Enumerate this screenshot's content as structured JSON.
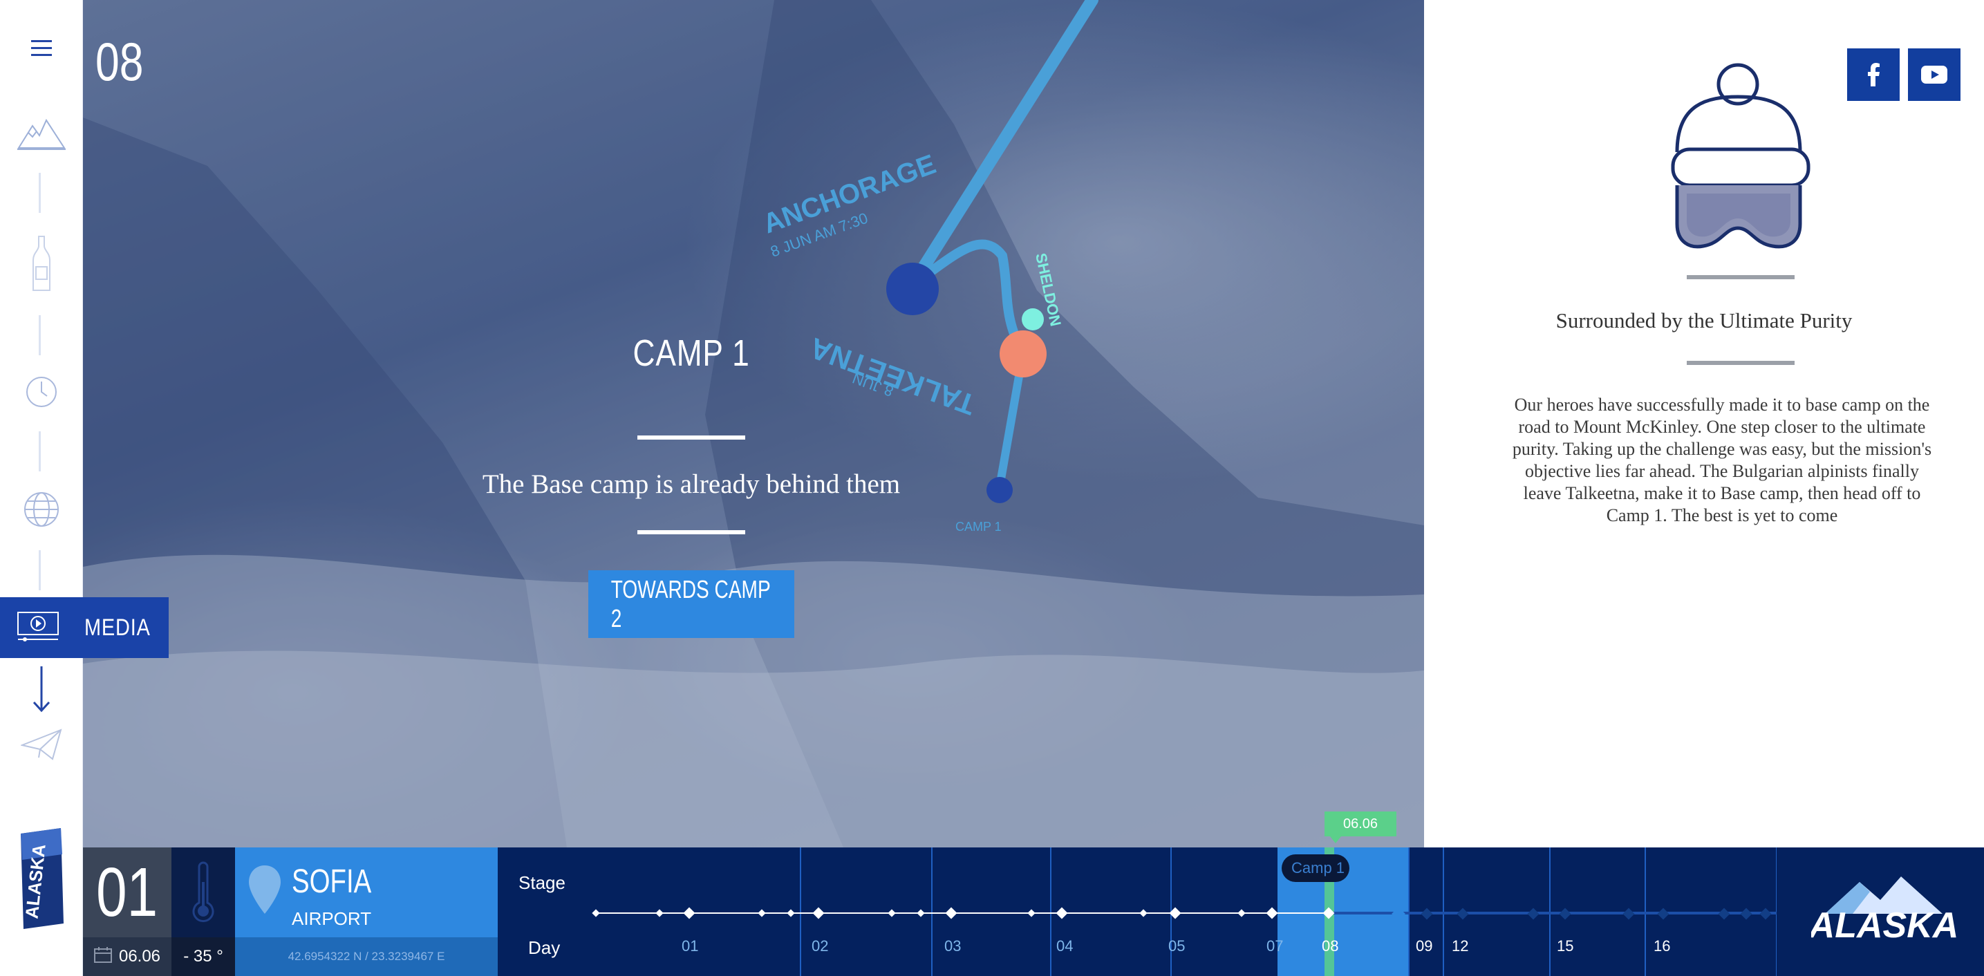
{
  "sidebar": {
    "media_label": "MEDIA",
    "icons": [
      "menu-icon",
      "mountain-icon",
      "bottle-icon",
      "clock-icon",
      "globe-icon",
      "media-play-icon",
      "arrow-down-icon",
      "paper-plane-icon"
    ],
    "logo_text": "ALASKA"
  },
  "hero": {
    "stage_number": "08",
    "title": "CAMP 1",
    "subtitle": "The Base camp is already behind them",
    "cta_label": "TOWARDS CAMP 2",
    "route_labels": {
      "anchorage": "ANCHORAGE",
      "anchorage_date": "8 JUN AM 7:30",
      "sheldon": "SHELDON",
      "talkeetna": "TALKEETNA",
      "talkeetna_date": "8 JUN",
      "camp1": "CAMP 1"
    },
    "colors": {
      "route": "#4aa0d8",
      "anchorage": "#2446a6",
      "talkeetna": "#f28a70",
      "sheldon": "#7ef0e0"
    }
  },
  "panel": {
    "social": [
      "facebook-icon",
      "youtube-icon"
    ],
    "title": "Surrounded by the Ultimate Purity",
    "body": "Our heroes have successfully made it to base camp on the road to Mount McKinley. One step closer to the ultimate purity. Taking up the challenge was easy, but the mission's objective lies far ahead. The Bulgarian alpinists finally leave Talkeetna, make it to Base camp, then head off to Camp 1. The best is yet to come"
  },
  "bottom": {
    "day": "01",
    "date": "06.06",
    "temperature": "- 35 °",
    "city": "SOFIA",
    "location_sub": "AIRPORT",
    "coordinates": "42.6954322 N / 23.3239467 E",
    "stage_label": "Stage",
    "day_label": "Day",
    "current_date_tag": "06.06",
    "current_stage_tooltip": "Camp 1",
    "day_ticks": [
      "01",
      "02",
      "03",
      "04",
      "05",
      "07",
      "08",
      "09",
      "12",
      "15",
      "16"
    ],
    "logo_text": "ALASKA"
  }
}
